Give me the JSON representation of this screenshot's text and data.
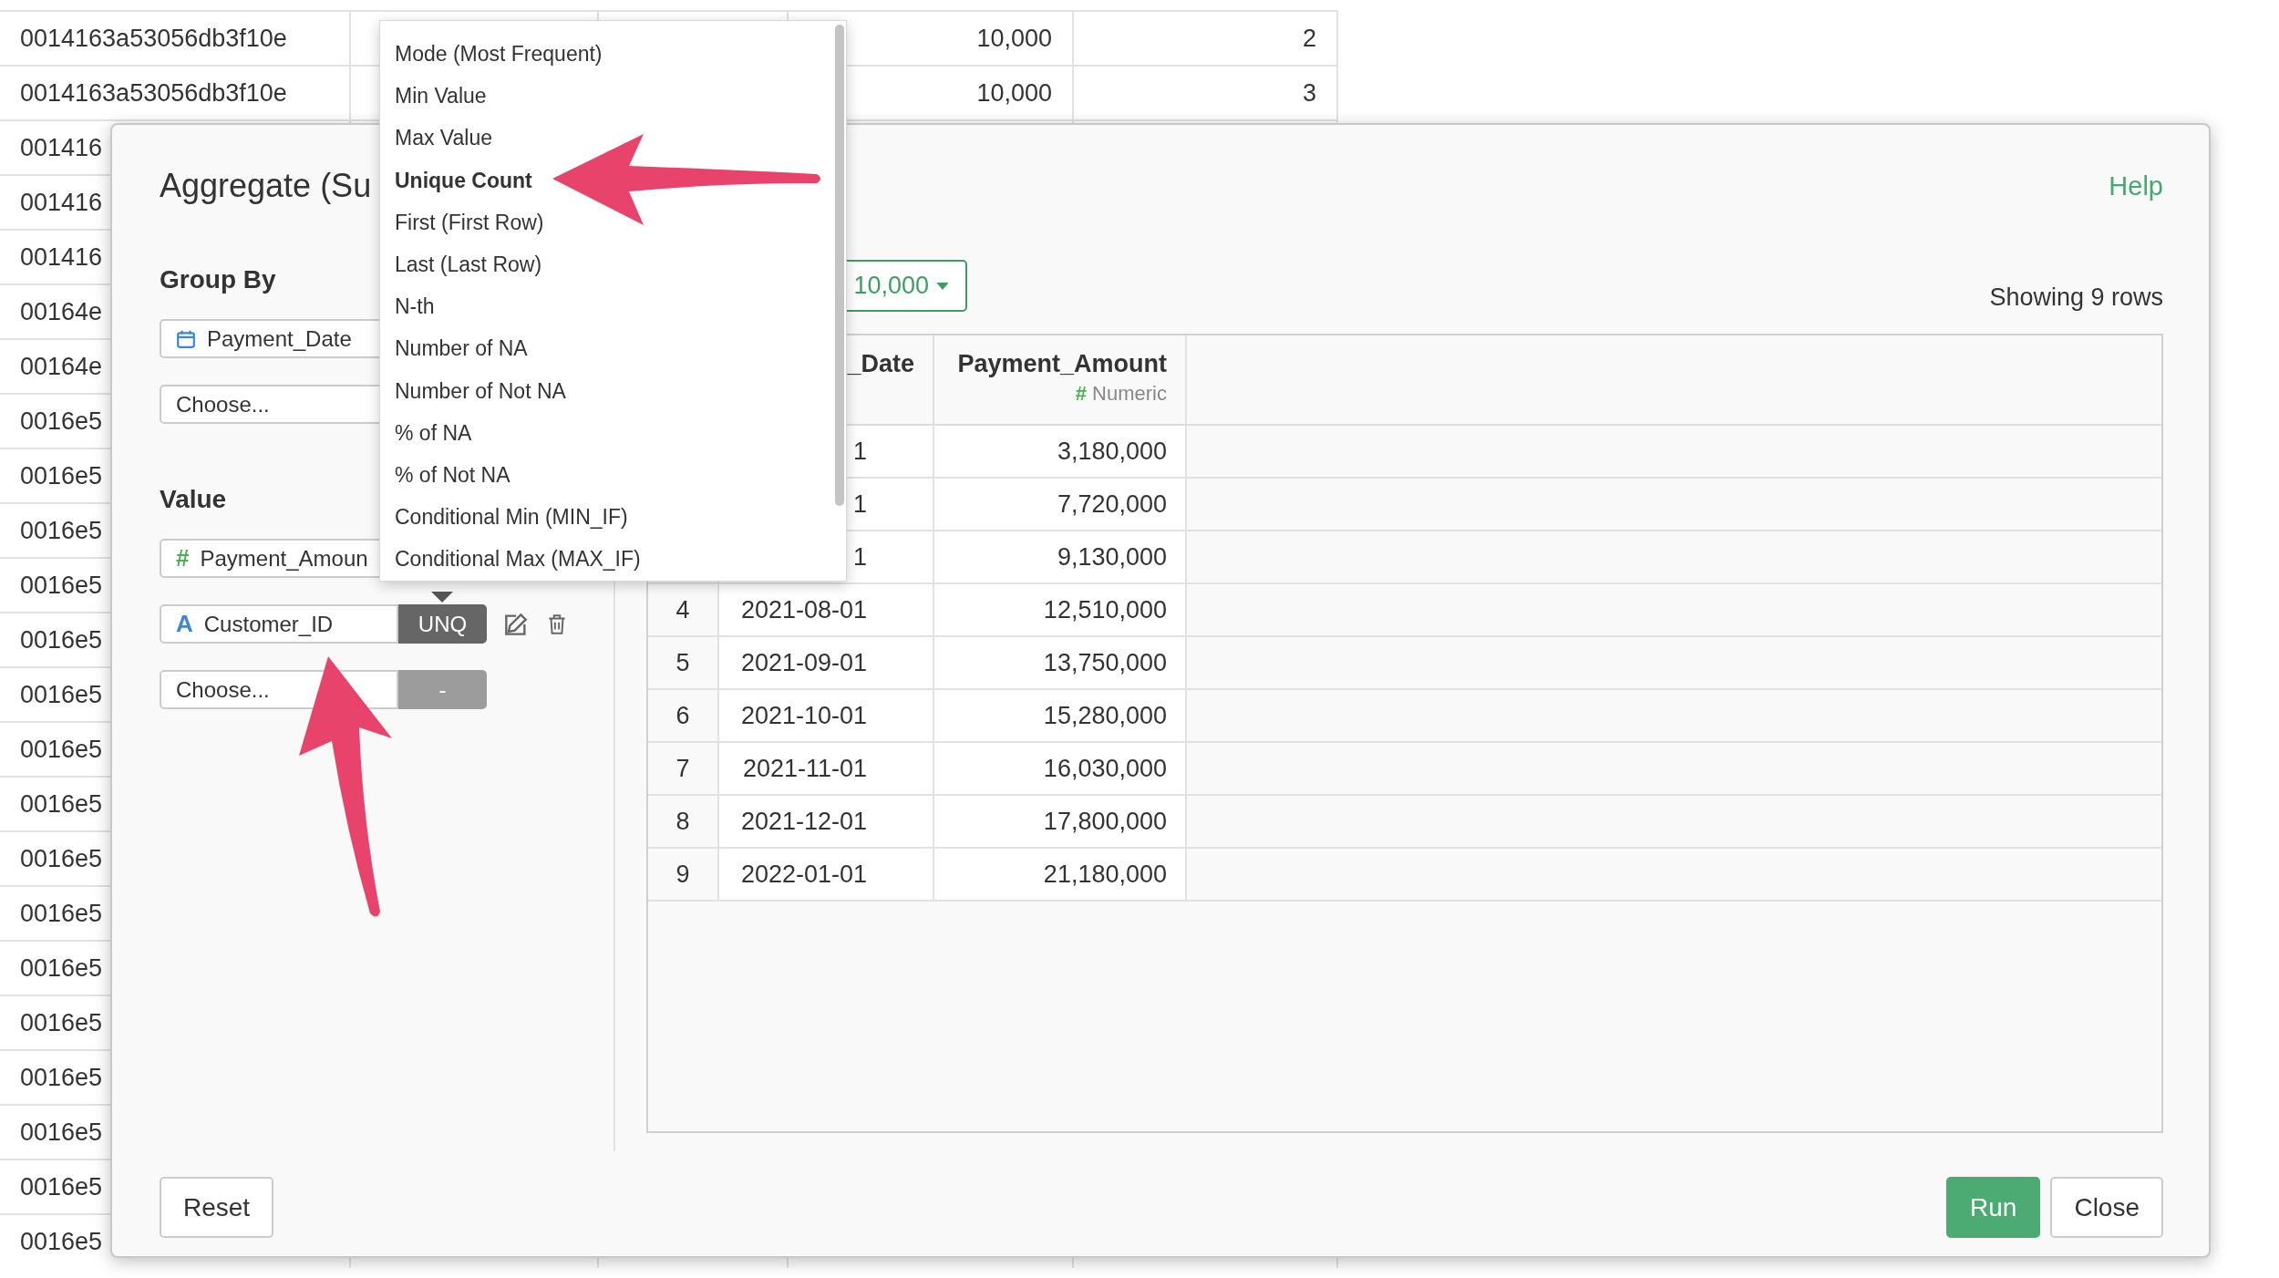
{
  "sheet": {
    "rows": [
      {
        "column_1": "0014163a53056db3f10e",
        "column_4": "10,000",
        "column_5": "2"
      },
      {
        "column_1": "0014163a53056db3f10e",
        "column_4": "10,000",
        "column_5": "3"
      },
      {
        "column_1": "001416"
      },
      {
        "column_1": "001416"
      },
      {
        "column_1": "001416"
      },
      {
        "column_1": "00164e"
      },
      {
        "column_1": "00164e"
      },
      {
        "column_1": "0016e5"
      },
      {
        "column_1": "0016e5"
      },
      {
        "column_1": "0016e5"
      },
      {
        "column_1": "0016e5"
      },
      {
        "column_1": "0016e5"
      },
      {
        "column_1": "0016e5"
      },
      {
        "column_1": "0016e5"
      },
      {
        "column_1": "0016e5"
      },
      {
        "column_1": "0016e5"
      },
      {
        "column_1": "0016e5"
      },
      {
        "column_1": "0016e5"
      },
      {
        "column_1": "0016e5"
      },
      {
        "column_1": "0016e5"
      },
      {
        "column_1": "0016e5"
      },
      {
        "column_1": "0016e5"
      },
      {
        "column_1": "0016e5"
      }
    ]
  },
  "dialog": {
    "title": "Aggregate (Su",
    "help_link": "Help",
    "group_by": {
      "label": "Group By",
      "fields": [
        {
          "kind": "date",
          "text": "Payment_Date"
        },
        {
          "kind": "empty",
          "text": "Choose..."
        }
      ]
    },
    "value": {
      "label": "Value",
      "fields": [
        {
          "kind": "number",
          "type_icon": "#",
          "text": "Payment_Amoun"
        },
        {
          "kind": "string",
          "type_icon": "A",
          "text": "Customer_ID",
          "function": "UNQ",
          "disabled": false
        },
        {
          "kind": "empty",
          "text": "Choose...",
          "function": "-",
          "disabled": true
        }
      ]
    },
    "limit_button": "10,000",
    "row_count": "Showing 9 rows",
    "table": {
      "columns": [
        {
          "name": "_Date"
        },
        {
          "name": "Payment_Amount",
          "type_icon": "#",
          "type": "Numeric"
        }
      ],
      "rows": [
        {
          "date": "1",
          "amount": "3,180,000"
        },
        {
          "date": "1",
          "amount": "7,720,000"
        },
        {
          "date": "1",
          "amount": "9,130,000"
        },
        {
          "number": "4",
          "date": "2021-08-01",
          "amount": "12,510,000"
        },
        {
          "number": "5",
          "date": "2021-09-01",
          "amount": "13,750,000"
        },
        {
          "number": "6",
          "date": "2021-10-01",
          "amount": "15,280,000"
        },
        {
          "number": "7",
          "date": "2021-11-01",
          "amount": "16,030,000"
        },
        {
          "number": "8",
          "date": "2021-12-01",
          "amount": "17,800,000"
        },
        {
          "number": "9",
          "date": "2022-01-01",
          "amount": "21,180,000"
        }
      ]
    },
    "buttons": {
      "reset": "Reset",
      "run": "Run",
      "close": "Close"
    }
  },
  "dropdown": {
    "items": [
      {
        "label": "Mode (Most Frequent)",
        "selected": false
      },
      {
        "label": "Min Value",
        "selected": false
      },
      {
        "label": "Max Value",
        "selected": false
      },
      {
        "label": "Unique Count",
        "selected": true
      },
      {
        "label": "First (First Row)",
        "selected": false
      },
      {
        "label": "Last (Last Row)",
        "selected": false
      },
      {
        "label": "N-th",
        "selected": false
      },
      {
        "label": "Number of NA",
        "selected": false
      },
      {
        "label": "Number of Not NA",
        "selected": false
      },
      {
        "label": "% of NA",
        "selected": false
      },
      {
        "label": "% of Not NA",
        "selected": false
      },
      {
        "label": "Conditional Min (MIN_IF)",
        "selected": false
      },
      {
        "label": "Conditional Max (MAX_IF)",
        "selected": false
      }
    ]
  }
}
